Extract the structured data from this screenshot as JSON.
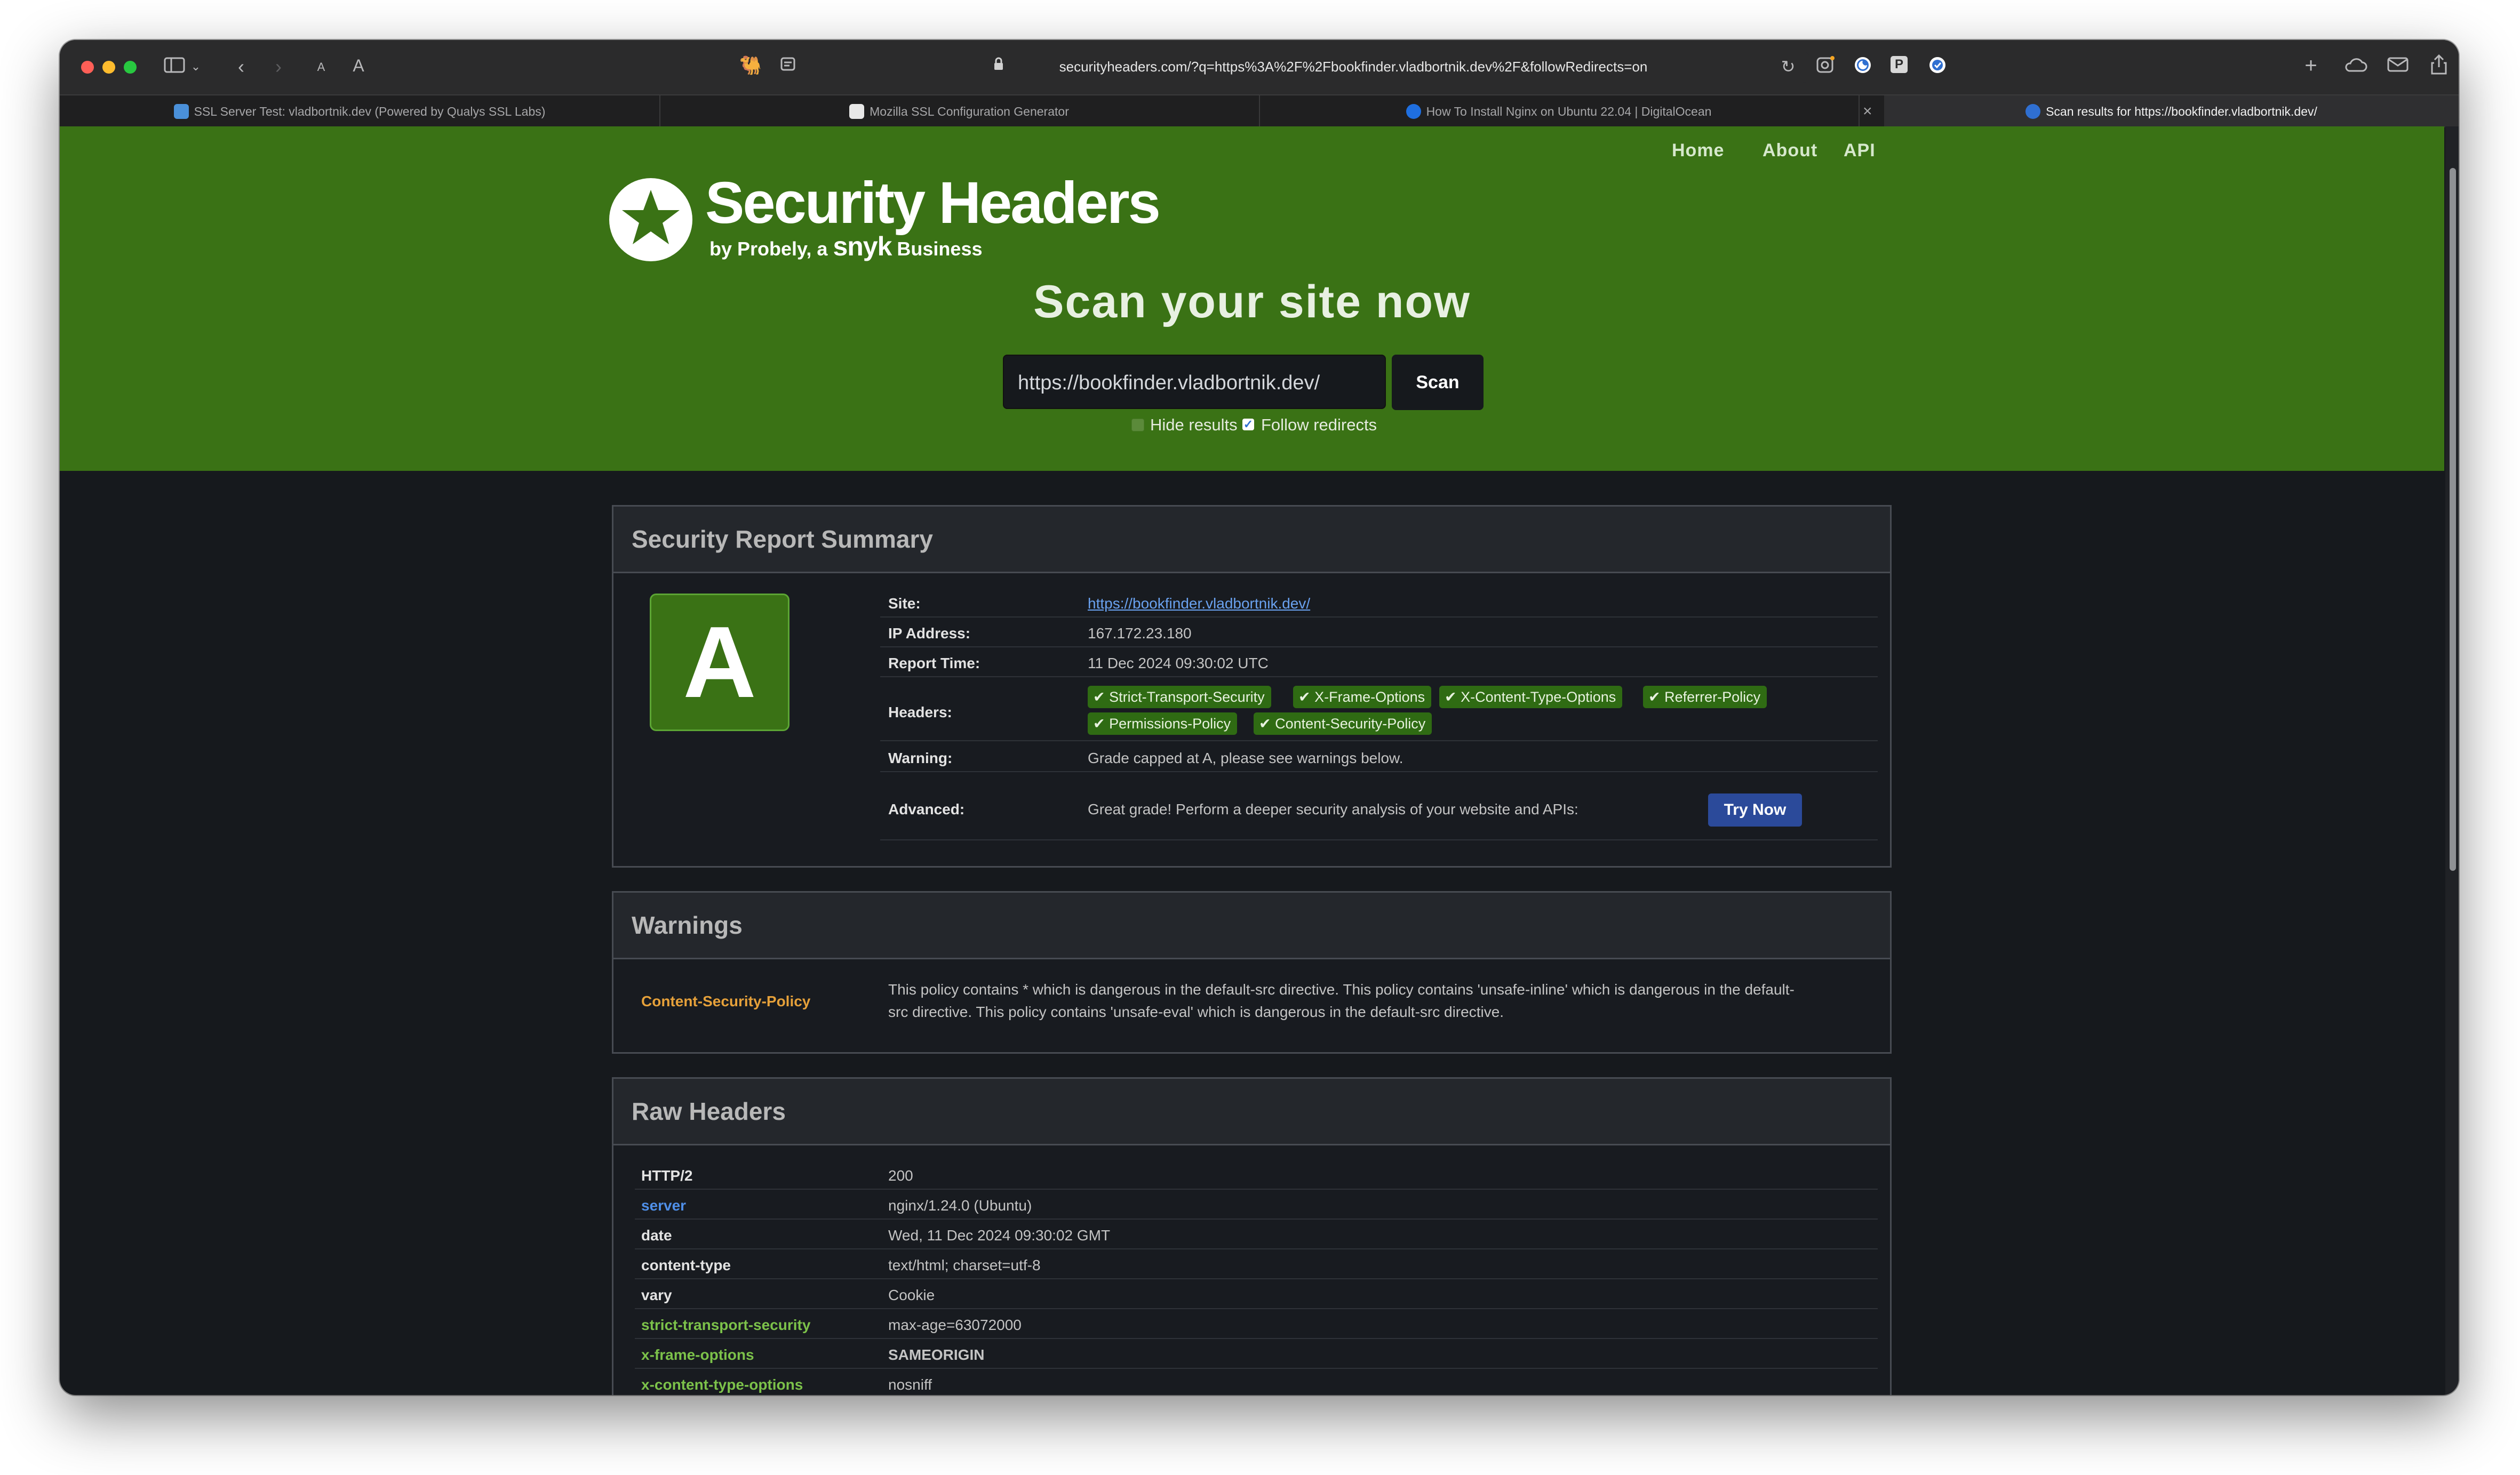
{
  "browser": {
    "url": "securityheaders.com/?q=https%3A%2F%2Fbookfinder.vladbortnik.dev%2F&followRedirects=on",
    "reader_small": "A",
    "reader_large": "A",
    "ext_p_label": "P",
    "tabs": [
      {
        "label": "SSL Server Test: vladbortnik.dev (Powered by Qualys SSL Labs)"
      },
      {
        "label": "Mozilla SSL Configuration Generator"
      },
      {
        "label": "How To Install Nginx on Ubuntu 22.04 | DigitalOcean"
      },
      {
        "label": "Scan results for https://bookfinder.vladbortnik.dev/"
      }
    ],
    "close_tab_glyph": "×"
  },
  "nav": {
    "home": "Home",
    "about": "About",
    "api": "API"
  },
  "logo": {
    "title": "Security Headers",
    "sub_prefix": "by Probely, a",
    "sub_brand": "snyk",
    "sub_suffix": "Business"
  },
  "hero": {
    "title": "Scan your site now",
    "input_value": "https://bookfinder.vladbortnik.dev/",
    "scan_label": "Scan",
    "hide_results_label": "Hide results",
    "hide_results_checked": false,
    "follow_redirects_label": "Follow redirects",
    "follow_redirects_checked": true
  },
  "summary": {
    "title": "Security Report Summary",
    "grade": "A",
    "grade_color": "#3a7215",
    "site_label": "Site:",
    "site_value": "https://bookfinder.vladbortnik.dev/",
    "ip_label": "IP Address:",
    "ip_value": "167.172.23.180",
    "time_label": "Report Time:",
    "time_value": "11 Dec 2024 09:30:02 UTC",
    "headers_label": "Headers:",
    "headers": [
      "Strict-Transport-Security",
      "X-Frame-Options",
      "X-Content-Type-Options",
      "Referrer-Policy",
      "Permissions-Policy",
      "Content-Security-Policy"
    ],
    "warning_label": "Warning:",
    "warning_value": "Grade capped at A, please see warnings below.",
    "advanced_label": "Advanced:",
    "advanced_value": "Great grade! Perform a deeper security analysis of your website and APIs:",
    "try_now_label": "Try Now"
  },
  "warnings": {
    "title": "Warnings",
    "header_name": "Content-Security-Policy",
    "line1": "This policy contains * which is dangerous in the default-src directive. This policy contains 'unsafe-inline' which is dangerous in the default-",
    "line2": "src directive. This policy contains 'unsafe-eval' which is dangerous in the default-src directive."
  },
  "raw": {
    "title": "Raw Headers",
    "rows": [
      {
        "name": "HTTP/2",
        "value": "200",
        "name_color": "#e3e3e3"
      },
      {
        "name": "server",
        "value": "nginx/1.24.0 (Ubuntu)",
        "name_color": "#4f8fe8"
      },
      {
        "name": "date",
        "value": "Wed, 11 Dec 2024 09:30:02 GMT",
        "name_color": "#e3e3e3"
      },
      {
        "name": "content-type",
        "value": "text/html; charset=utf-8",
        "name_color": "#e3e3e3"
      },
      {
        "name": "vary",
        "value": "Cookie",
        "name_color": "#e3e3e3"
      },
      {
        "name": "strict-transport-security",
        "value": "max-age=63072000",
        "name_color": "#7cc24a"
      },
      {
        "name": "x-frame-options",
        "value": "SAMEORIGIN",
        "name_color": "#7cc24a"
      },
      {
        "name": "x-content-type-options",
        "value": "nosniff",
        "name_color": "#7cc24a"
      }
    ]
  },
  "colors": {
    "hero_green": "#3a7215",
    "pill_green": "#2f6b13",
    "warning_orange": "#e6a13a",
    "link_blue": "#4f8fe8",
    "try_now_blue": "#2b4a9a"
  }
}
